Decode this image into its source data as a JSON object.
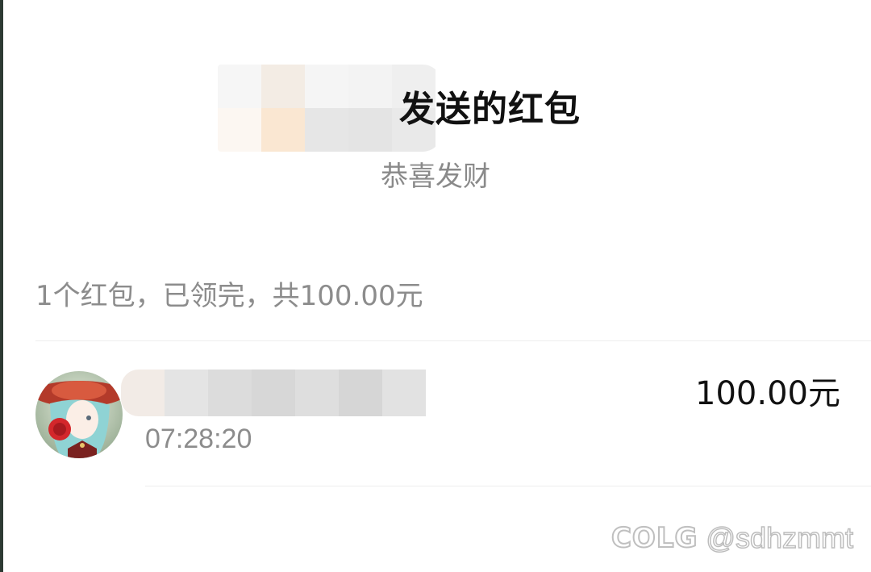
{
  "header": {
    "title_suffix": "发送的红包",
    "greeting": "恭喜发财"
  },
  "summary": {
    "text": "1个红包，已领完，共100.00元"
  },
  "records": [
    {
      "time": "07:28:20",
      "amount": "100.00元"
    }
  ],
  "watermark": {
    "logo": "COLG",
    "handle": "@sdhzmmt"
  },
  "colors": {
    "title": "#111111",
    "secondary_text": "#8c8c8c",
    "divider": "#eeeeee",
    "background": "#ffffff"
  },
  "icons": {
    "avatar": "user-avatar-anime-girl"
  }
}
